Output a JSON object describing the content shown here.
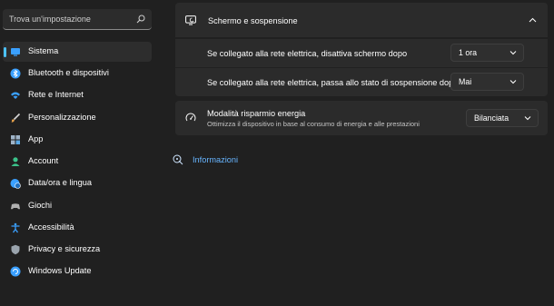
{
  "search": {
    "placeholder": "Trova un'impostazione"
  },
  "sidebar": {
    "items": [
      {
        "label": "Sistema",
        "icon": "system-display-icon",
        "color": "#3aa0ff",
        "selected": true
      },
      {
        "label": "Bluetooth e dispositivi",
        "icon": "bluetooth-icon",
        "color": "#3aa0ff"
      },
      {
        "label": "Rete e Internet",
        "icon": "wifi-icon",
        "color": "#3aa0ff"
      },
      {
        "label": "Personalizzazione",
        "icon": "brush-icon",
        "color": "#e8a24b"
      },
      {
        "label": "App",
        "icon": "apps-icon",
        "color": "#9fb4c8"
      },
      {
        "label": "Account",
        "icon": "account-icon",
        "color": "#3bc28a"
      },
      {
        "label": "Data/ora e lingua",
        "icon": "globe-clock-icon",
        "color": "#3aa0ff"
      },
      {
        "label": "Giochi",
        "icon": "gamepad-icon",
        "color": "#b0b0b0"
      },
      {
        "label": "Accessibilità",
        "icon": "accessibility-icon",
        "color": "#3aa0ff"
      },
      {
        "label": "Privacy e sicurezza",
        "icon": "shield-icon",
        "color": "#9aa4ad"
      },
      {
        "label": "Windows Update",
        "icon": "windows-update-icon",
        "color": "#3aa0ff"
      }
    ]
  },
  "screen_sleep": {
    "title": "Schermo e sospensione",
    "expanded": true,
    "rows": [
      {
        "label": "Se collegato alla rete elettrica, disattiva schermo dopo",
        "value": "1 ora"
      },
      {
        "label": "Se collegato alla rete elettrica, passa allo stato di sospensione dopo",
        "value": "Mai"
      }
    ]
  },
  "power_mode": {
    "title": "Modalità risparmio energia",
    "subtitle": "Ottimizza il dispositivo in base al consumo di energia e alle prestazioni",
    "value": "Bilanciata"
  },
  "info_link": {
    "label": "Informazioni"
  },
  "colors": {
    "accent": "#4cc2ff",
    "link": "#67b5ff",
    "background": "#202020",
    "card": "#2b2b2b"
  }
}
